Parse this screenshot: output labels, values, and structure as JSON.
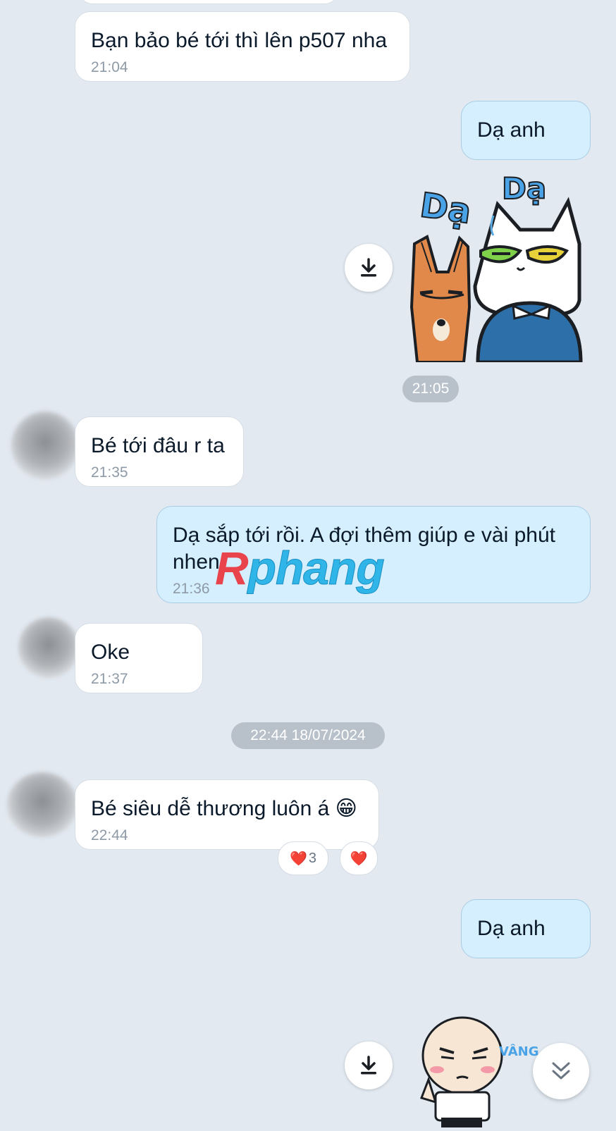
{
  "messages": [
    {
      "text": "Bạn bảo bé tới thì lên p507 nha",
      "time": "21:04"
    },
    {
      "text": "Dạ anh"
    },
    {
      "sticker": "cat-fox-da-da-sticker",
      "text1": "Dạ",
      "text2": "Dạ"
    },
    {
      "time_pill": "21:05"
    },
    {
      "text": "Bé tới đâu r ta",
      "time": "21:35"
    },
    {
      "text": "Dạ sắp tới rồi. A đợi thêm giúp e vài phút nhen",
      "time": "21:36"
    },
    {
      "text": "Oke",
      "time": "21:37"
    },
    {
      "text": "Bé siêu dễ thương luôn á 😁",
      "time": "22:44",
      "reactions": [
        {
          "emoji": "❤️",
          "count": "3"
        },
        {
          "emoji": "❤️"
        }
      ]
    },
    {
      "text": "Dạ anh"
    },
    {
      "sticker": "bald-boy-vang-sticker",
      "caption": "VÂNG ..."
    }
  ],
  "separator": "22:44 18/07/2024",
  "watermark": {
    "r": "R",
    "rest": "phang"
  },
  "icons": {
    "download": "download-icon",
    "scroll_down": "chevron-double-down-icon"
  },
  "colors": {
    "background": "#e2e9f1",
    "incoming": "#ffffff",
    "outgoing": "#d5efff"
  }
}
